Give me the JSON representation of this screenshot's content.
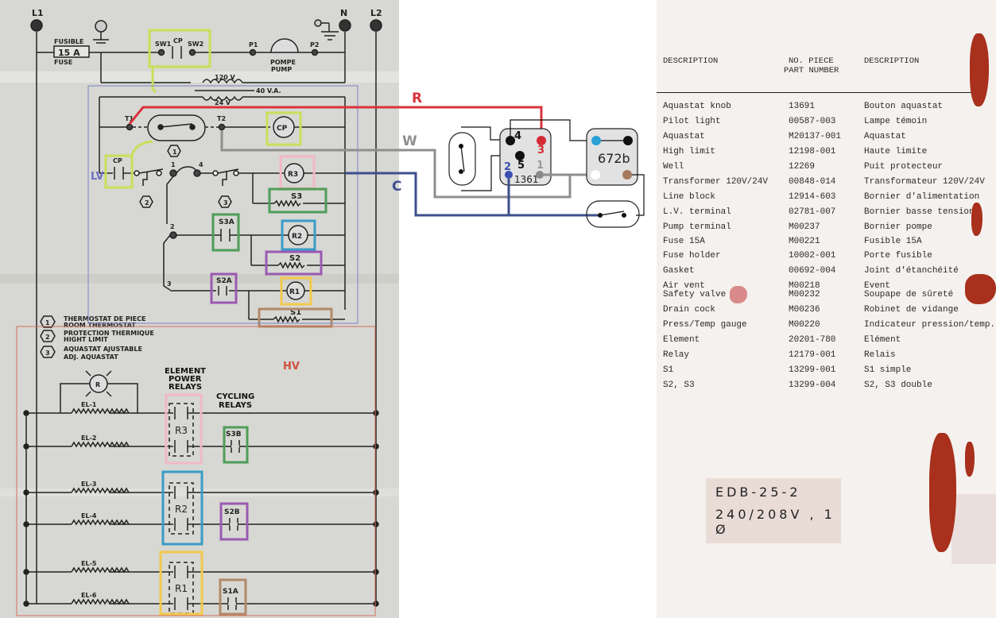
{
  "schematic": {
    "terminals": {
      "l1": "L1",
      "n": "N",
      "l2": "L2"
    },
    "fuse": {
      "label_fr": "FUSIBLE",
      "value": "15 A",
      "label_en": "FUSE"
    },
    "switch": {
      "sw1": "SW1",
      "cp": "CP",
      "sw2": "SW2"
    },
    "pump": {
      "p1": "P1",
      "p2": "P2",
      "label_fr": "POMPE",
      "label_en": "PUMP"
    },
    "transformer": {
      "primary": "120 V",
      "rating": "40 V.A.",
      "secondary": "24 V"
    },
    "thermostat": {
      "t1": "T1",
      "t2": "T2",
      "marker": "1"
    },
    "lv_components": {
      "cp_coil": "CP",
      "cp_contact": "CP",
      "hl_marker": "2",
      "aq_marker": "3",
      "terminal_1": "1",
      "terminal_4": "4",
      "terminal_2": "2",
      "terminal_3": "3",
      "r3": "R3",
      "s3": "S3",
      "s3a": "S3A",
      "r2": "R2",
      "s2": "S2",
      "s2a": "S2A",
      "r1": "R1",
      "s1": "S1"
    },
    "zone_labels": {
      "lv": "LV",
      "hv": "HV"
    },
    "legend": [
      {
        "num": "1",
        "fr": "THERMOSTAT DE PIECE",
        "en": "ROOM THERMOSTAT"
      },
      {
        "num": "2",
        "fr": "PROTECTION THERMIQUE",
        "en": "HIGHT LIMIT"
      },
      {
        "num": "3",
        "fr": "AQUASTAT AJUSTABLE",
        "en": "ADJ. AQUASTAT"
      }
    ],
    "hv": {
      "pilot": "R",
      "element_relays_title": [
        "ELEMENT",
        "POWER",
        "RELAYS"
      ],
      "cycling_title": [
        "CYCLING",
        "RELAYS"
      ],
      "elements": [
        "EL-1",
        "EL-2",
        "EL-3",
        "EL-4",
        "EL-5",
        "EL-6"
      ],
      "relays": {
        "r3": "R3",
        "r2": "R2",
        "r1": "R1"
      },
      "cycling": {
        "s3b": "S3B",
        "s2b": "S2B",
        "s1a": "S1A"
      }
    }
  },
  "overlay": {
    "wire_labels": {
      "r": "R",
      "w": "W",
      "c": "C"
    },
    "relay_1361": {
      "model": "1361",
      "pins": [
        "4",
        "3",
        "5",
        "2",
        "1"
      ]
    },
    "relay_672b": {
      "model": "672b"
    },
    "colors": {
      "r": "#d9343c",
      "w": "#8f8f8f",
      "c": "#3d4f8c",
      "pin2": "#3a4fb0",
      "pin3": "#d42c35",
      "pin_blue": "#2aa0d8",
      "pin_brown": "#a47a5e"
    },
    "highlight_colors": {
      "yellowgreen": "#c8e05a",
      "pink": "#f2b8c6",
      "green": "#4e9d58",
      "blue": "#3a9cc8",
      "purple": "#9a5ab0",
      "yellow": "#f3c94c",
      "tan": "#b08a6a",
      "lv": "#7a80c8",
      "hv": "#d0705c"
    }
  },
  "parts_sheet": {
    "headers": {
      "desc_en": "DESCRIPTION",
      "part_no_fr": "NO. PIECE",
      "part_no_en": "PART NUMBER",
      "desc_fr": "DESCRIPTION"
    },
    "rows": [
      {
        "en": "Aquastat knob",
        "pn": "13691",
        "fr": "Bouton aquastat"
      },
      {
        "en": "Pilot light",
        "pn": "00587-003",
        "fr": "Lampe témoin"
      },
      {
        "en": "Aquastat",
        "pn": "M20137-001",
        "fr": "Aquastat"
      },
      {
        "en": "High limit",
        "pn": "12198-001",
        "fr": "Haute limite"
      },
      {
        "en": "Well",
        "pn": "12269",
        "fr": "Puit protecteur"
      },
      {
        "en": "Transformer 120V/24V",
        "pn": "00848-014",
        "fr": "Transformateur 120V/24V"
      },
      {
        "en": "Line block",
        "pn": "12914-603",
        "fr": "Bornier d'alimentation"
      },
      {
        "en": "L.V. terminal",
        "pn": "02781-007",
        "fr": "Bornier basse tension"
      },
      {
        "en": "Pump terminal",
        "pn": "M00237",
        "fr": "Bornier pompe"
      },
      {
        "en": "Fuse 15A",
        "pn": "M00221",
        "fr": "Fusible 15A"
      },
      {
        "en": "Fuse holder",
        "pn": "10002-001",
        "fr": "Porte fusible"
      },
      {
        "en": "Gasket",
        "pn": "00692-004",
        "fr": "Joint d'étanchéité"
      },
      {
        "en": "Air vent",
        "pn": "M00218",
        "fr": "Event"
      },
      {
        "en": "Safety valve",
        "pn": "M00232",
        "fr": "Soupape de sûreté"
      },
      {
        "en": "Drain cock",
        "pn": "M00236",
        "fr": "Robinet de vidange"
      },
      {
        "en": "Press/Temp gauge",
        "pn": "M00220",
        "fr": "Indicateur pression/temp."
      },
      {
        "en": "Element",
        "pn": "20201-780",
        "fr": "Elément"
      },
      {
        "en": "Relay",
        "pn": "12179-001",
        "fr": "Relais"
      },
      {
        "en": "S1",
        "pn": "13299-001",
        "fr": "S1 simple"
      },
      {
        "en": "S2, S3",
        "pn": "13299-004",
        "fr": "S2, S3 double"
      }
    ],
    "model_label": {
      "model": "EDB-25-2",
      "rating": "240/208V , 1 Ø"
    }
  }
}
